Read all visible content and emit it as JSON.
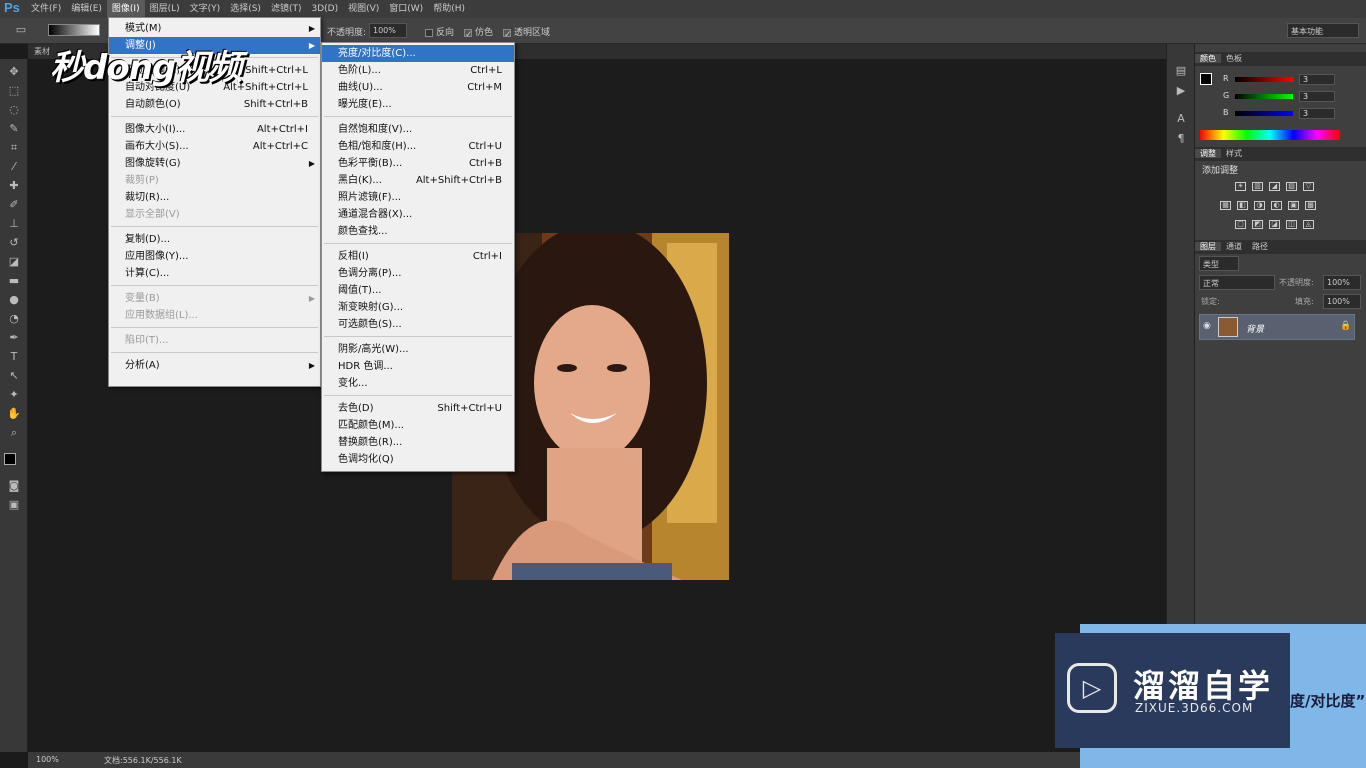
{
  "app": {
    "logo": "Ps"
  },
  "menubar": {
    "items": [
      "文件(F)",
      "编辑(E)",
      "图像(I)",
      "图层(L)",
      "文字(Y)",
      "选择(S)",
      "滤镜(T)",
      "3D(D)",
      "视图(V)",
      "窗口(W)",
      "帮助(H)"
    ],
    "active_index": 2
  },
  "options": {
    "opacity_label": "不透明度:",
    "opacity_value": "100%",
    "reverse_label": "反向",
    "dither_label": "仿色",
    "transparency_label": "透明区域",
    "workspace": "基本功能"
  },
  "doc_tab": {
    "label": "素材"
  },
  "image_menu": {
    "items": [
      {
        "label": "模式(M)",
        "shortcut": "",
        "sub": true
      },
      {
        "label": "调整(J)",
        "shortcut": "",
        "sub": true,
        "highlight": true
      },
      {
        "label": "自动色调(N)",
        "shortcut": "Shift+Ctrl+L"
      },
      {
        "label": "自动对比度(U)",
        "shortcut": "Alt+Shift+Ctrl+L"
      },
      {
        "label": "自动颜色(O)",
        "shortcut": "Shift+Ctrl+B"
      },
      {
        "label": "图像大小(I)...",
        "shortcut": "Alt+Ctrl+I"
      },
      {
        "label": "画布大小(S)...",
        "shortcut": "Alt+Ctrl+C"
      },
      {
        "label": "图像旋转(G)",
        "shortcut": "",
        "sub": true
      },
      {
        "label": "裁剪(P)",
        "shortcut": "",
        "disabled": true
      },
      {
        "label": "裁切(R)...",
        "shortcut": ""
      },
      {
        "label": "显示全部(V)",
        "shortcut": "",
        "disabled": true
      },
      {
        "label": "复制(D)...",
        "shortcut": ""
      },
      {
        "label": "应用图像(Y)...",
        "shortcut": ""
      },
      {
        "label": "计算(C)...",
        "shortcut": ""
      },
      {
        "label": "变量(B)",
        "shortcut": "",
        "sub": true,
        "disabled": true
      },
      {
        "label": "应用数据组(L)...",
        "shortcut": "",
        "disabled": true
      },
      {
        "label": "陷印(T)...",
        "shortcut": "",
        "disabled": true
      },
      {
        "label": "分析(A)",
        "shortcut": "",
        "sub": true
      }
    ]
  },
  "adjust_menu": {
    "items": [
      {
        "label": "亮度/对比度(C)...",
        "shortcut": "",
        "highlight": true
      },
      {
        "label": "色阶(L)...",
        "shortcut": "Ctrl+L"
      },
      {
        "label": "曲线(U)...",
        "shortcut": "Ctrl+M"
      },
      {
        "label": "曝光度(E)...",
        "shortcut": ""
      },
      {
        "label": "自然饱和度(V)...",
        "shortcut": ""
      },
      {
        "label": "色相/饱和度(H)...",
        "shortcut": "Ctrl+U"
      },
      {
        "label": "色彩平衡(B)...",
        "shortcut": "Ctrl+B"
      },
      {
        "label": "黑白(K)...",
        "shortcut": "Alt+Shift+Ctrl+B"
      },
      {
        "label": "照片滤镜(F)...",
        "shortcut": ""
      },
      {
        "label": "通道混合器(X)...",
        "shortcut": ""
      },
      {
        "label": "颜色查找...",
        "shortcut": ""
      },
      {
        "label": "反相(I)",
        "shortcut": "Ctrl+I"
      },
      {
        "label": "色调分离(P)...",
        "shortcut": ""
      },
      {
        "label": "阈值(T)...",
        "shortcut": ""
      },
      {
        "label": "渐变映射(G)...",
        "shortcut": ""
      },
      {
        "label": "可选颜色(S)...",
        "shortcut": ""
      },
      {
        "label": "阴影/高光(W)...",
        "shortcut": ""
      },
      {
        "label": "HDR 色调...",
        "shortcut": ""
      },
      {
        "label": "变化...",
        "shortcut": ""
      },
      {
        "label": "去色(D)",
        "shortcut": "Shift+Ctrl+U"
      },
      {
        "label": "匹配颜色(M)...",
        "shortcut": ""
      },
      {
        "label": "替换颜色(R)...",
        "shortcut": ""
      },
      {
        "label": "色调均化(Q)",
        "shortcut": ""
      }
    ]
  },
  "color_panel": {
    "tabs": [
      "颜色",
      "色板"
    ],
    "r_label": "R",
    "g_label": "G",
    "b_label": "B",
    "r": "3",
    "g": "3",
    "b": "3"
  },
  "adjust_panel": {
    "tabs": [
      "调整",
      "样式"
    ],
    "title": "添加调整"
  },
  "layers_panel": {
    "tabs": [
      "图层",
      "通道",
      "路径"
    ],
    "kind": "类型",
    "blend": "正常",
    "opacity_label": "不透明度:",
    "opacity": "100%",
    "lock_label": "锁定:",
    "fill_label": "填充:",
    "fill": "100%",
    "layer_name": "背景"
  },
  "status": {
    "zoom": "100%",
    "doc": "文档:556.1K/556.1K"
  },
  "watermark": {
    "brand": "秒dong视频",
    "promo_title": "溜溜自学",
    "promo_url": "ZIXUE.3D66.COM",
    "promo_text": "度/对比度”"
  },
  "colors": {
    "highlight": "#3272c7",
    "menu_bg": "#f0f0f0",
    "canvas": "#1c1c1c"
  }
}
